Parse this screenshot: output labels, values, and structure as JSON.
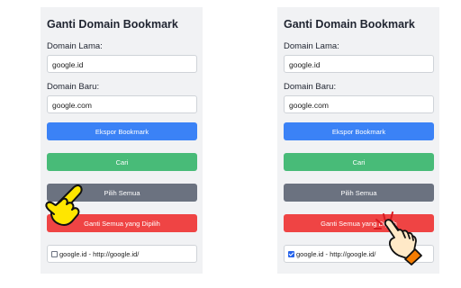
{
  "left": {
    "title": "Ganti Domain Bookmark",
    "old_domain_label": "Domain Lama:",
    "old_domain_value": "google.id",
    "new_domain_label": "Domain Baru:",
    "new_domain_value": "google.com",
    "export_label": "Ekspor Bookmark",
    "search_label": "Cari",
    "select_all_label": "Pilih Semua",
    "replace_label": "Ganti Semua yang Dipilih",
    "bookmark_item": "google.id - http://google.id/",
    "bookmark_checked": false
  },
  "right": {
    "title": "Ganti Domain Bookmark",
    "old_domain_label": "Domain Lama:",
    "old_domain_value": "google.id",
    "new_domain_label": "Domain Baru:",
    "new_domain_value": "google.com",
    "export_label": "Ekspor Bookmark",
    "search_label": "Cari",
    "select_all_label": "Pilih Semua",
    "replace_label": "Ganti Semua yang Dipilih",
    "bookmark_item": "google.id - http://google.id/",
    "bookmark_checked": true
  },
  "colors": {
    "primary_blue": "#3b82f6",
    "success_green": "#48bb78",
    "neutral_gray": "#6b7280",
    "danger_red": "#ef4444",
    "hand_yellow": "#ffe600",
    "hand_skin": "#ffe9c7"
  },
  "icons": {
    "left_pointer": "pointing-hand-icon",
    "right_pointer": "clicking-hand-icon"
  }
}
